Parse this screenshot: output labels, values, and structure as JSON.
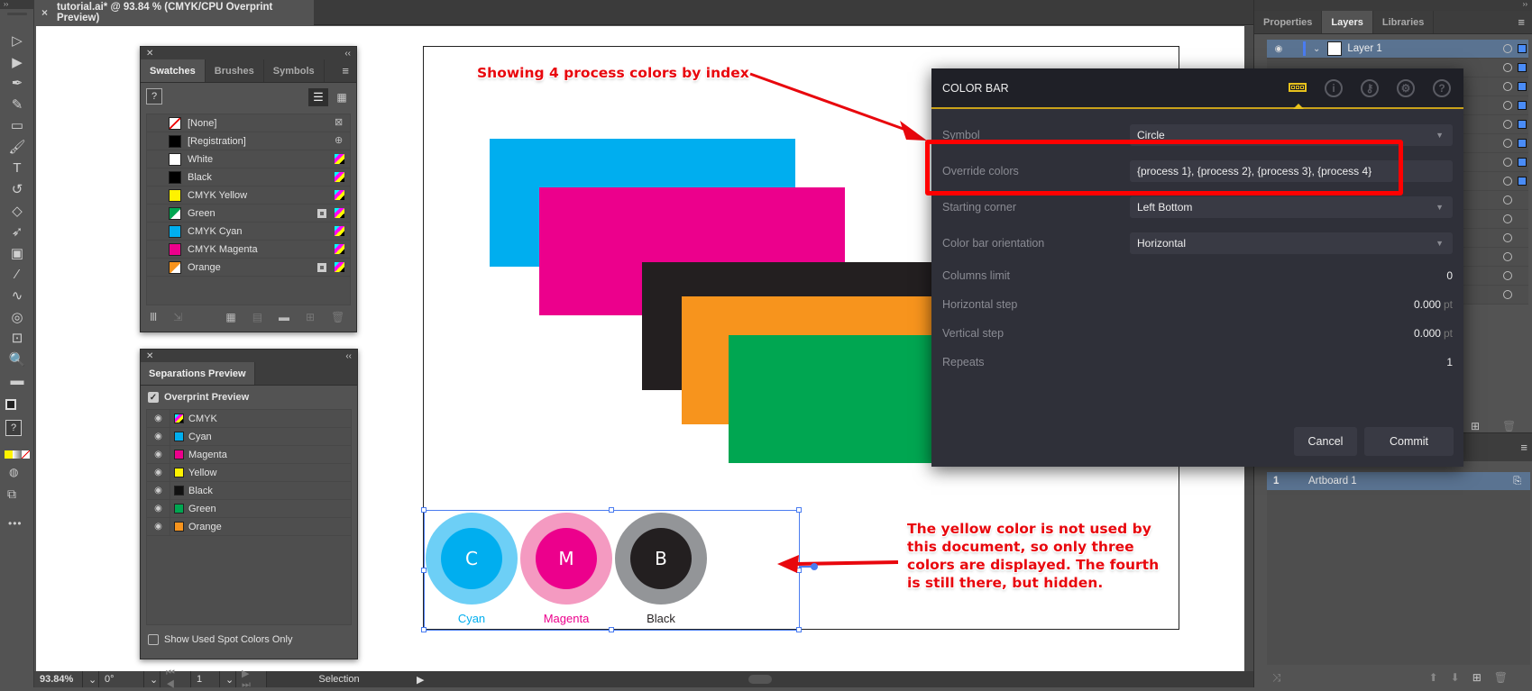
{
  "app": {
    "document_tab": "tutorial.ai* @ 93.84 % (CMYK/CPU Overprint Preview)",
    "tab_close": "×"
  },
  "toolbar": {
    "tools": [
      {
        "name": "selection-tool",
        "glyph": "▷"
      },
      {
        "name": "direct-selection-tool",
        "glyph": "▶"
      },
      {
        "name": "pen-tool",
        "glyph": "✒"
      },
      {
        "name": "curvature-tool",
        "glyph": "✎"
      },
      {
        "name": "rectangle-tool",
        "glyph": "▭"
      },
      {
        "name": "paintbrush-tool",
        "glyph": "🖌"
      },
      {
        "name": "type-tool",
        "glyph": "T"
      },
      {
        "name": "rotate-tool",
        "glyph": "↺"
      },
      {
        "name": "eraser-tool",
        "glyph": "◇"
      },
      {
        "name": "lasso-tool",
        "glyph": "➶"
      },
      {
        "name": "gradient-tool",
        "glyph": "▣"
      },
      {
        "name": "eyedropper-tool",
        "glyph": "⁄"
      },
      {
        "name": "puppet-warp-tool",
        "glyph": "∿"
      },
      {
        "name": "shape-builder-tool",
        "glyph": "◎"
      },
      {
        "name": "artboard-tool",
        "glyph": "⊡"
      },
      {
        "name": "zoom-tool",
        "glyph": "🔍"
      },
      {
        "name": "measure-tool",
        "glyph": "▬"
      }
    ],
    "more": "•••"
  },
  "swatches_panel": {
    "tabs": [
      "Swatches",
      "Brushes",
      "Symbols"
    ],
    "active_tab": "Swatches",
    "fill_stroke_indicator": "?",
    "items": [
      {
        "name": "[None]",
        "color": "none",
        "type": "none"
      },
      {
        "name": "[Registration]",
        "color": "#000000",
        "type": "registration"
      },
      {
        "name": "White",
        "color": "#ffffff",
        "type": "process"
      },
      {
        "name": "Black",
        "color": "#000000",
        "type": "process"
      },
      {
        "name": "CMYK Yellow",
        "color": "#fff200",
        "type": "process"
      },
      {
        "name": "Green",
        "color": "#00a651",
        "type": "global"
      },
      {
        "name": "CMYK Cyan",
        "color": "#00aeef",
        "type": "process"
      },
      {
        "name": "CMYK Magenta",
        "color": "#ec008c",
        "type": "process"
      },
      {
        "name": "Orange",
        "color": "#f7941d",
        "type": "global"
      }
    ]
  },
  "separations_panel": {
    "title": "Separations Preview",
    "overprint_preview_label": "Overprint Preview",
    "overprint_preview_checked": true,
    "items": [
      {
        "name": "CMYK",
        "color": "cmyk"
      },
      {
        "name": "Cyan",
        "color": "#00aeef"
      },
      {
        "name": "Magenta",
        "color": "#ec008c"
      },
      {
        "name": "Yellow",
        "color": "#fff200"
      },
      {
        "name": "Black",
        "color": "#111111"
      },
      {
        "name": "Green",
        "color": "#00a651"
      },
      {
        "name": "Orange",
        "color": "#f7941d"
      }
    ],
    "show_spot_only_label": "Show Used Spot Colors Only",
    "show_spot_only_checked": false
  },
  "artboard": {
    "rectangles": [
      {
        "name": "cyan-rect",
        "color": "#00aeef"
      },
      {
        "name": "magenta-rect",
        "color": "#ec008c"
      },
      {
        "name": "black-rect",
        "color": "#231f20"
      },
      {
        "name": "orange-rect",
        "color": "#f7941d"
      },
      {
        "name": "green-rect",
        "color": "#00a651"
      }
    ],
    "color_bar": [
      {
        "letter": "C",
        "label": "Cyan",
        "inner": "#00aeef",
        "outer": "#6dcff6",
        "label_color": "#00aeef"
      },
      {
        "letter": "M",
        "label": "Magenta",
        "inner": "#ec008c",
        "outer": "#f49ac1",
        "label_color": "#ec008c"
      },
      {
        "letter": "B",
        "label": "Black",
        "inner": "#231f20",
        "outer": "#939598",
        "label_color": "#231f20"
      }
    ]
  },
  "annotations": {
    "top": "Showing 4 process colors by index",
    "bottom": "The yellow color is not used by this document, so only three colors are displayed. The fourth is still there, but hidden.",
    "bottom_lines": [
      "The yellow color is not used by",
      "this document, so only three",
      "colors are displayed. The fourth",
      "is still there, but hidden."
    ],
    "accent": "#e8070d"
  },
  "dialog": {
    "title": "COLOR BAR",
    "tab_icons": [
      "color-bar-icon",
      "info-icon",
      "key-icon",
      "settings-icon",
      "help-icon"
    ],
    "accent": "#c9a21a",
    "fields": {
      "symbol": {
        "label": "Symbol",
        "value": "Circle"
      },
      "override_colors": {
        "label": "Override colors",
        "value": "{process 1}, {process 2}, {process 3}, {process 4}"
      },
      "starting_corner": {
        "label": "Starting corner",
        "value": "Left Bottom"
      },
      "orientation": {
        "label": "Color bar orientation",
        "value": "Horizontal"
      },
      "columns_limit": {
        "label": "Columns limit",
        "value": "0"
      },
      "horizontal_step": {
        "label": "Horizontal step",
        "value": "0.000",
        "unit": "pt"
      },
      "vertical_step": {
        "label": "Vertical step",
        "value": "0.000",
        "unit": "pt"
      },
      "repeats": {
        "label": "Repeats",
        "value": "1"
      }
    },
    "cancel_label": "Cancel",
    "commit_label": "Commit"
  },
  "right_panel": {
    "tabs": [
      "Properties",
      "Layers",
      "Libraries"
    ],
    "active_tab": "Layers",
    "layer_name": "Layer 1",
    "layer_rows": 14,
    "artboards": [
      {
        "number": "1",
        "name": "Artboard 1"
      }
    ]
  },
  "status_bar": {
    "zoom": "93.84%",
    "rotation": "0°",
    "artboard_number": "1",
    "current_tool": "Selection"
  }
}
